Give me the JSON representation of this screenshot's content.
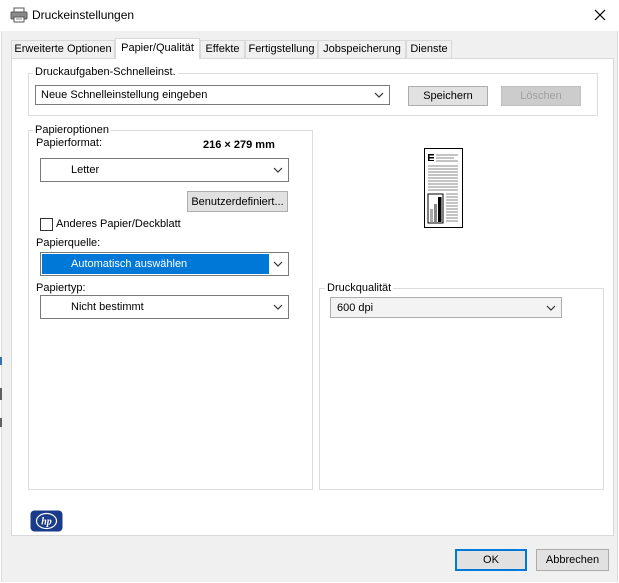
{
  "window": {
    "title": "Druckeinstellungen",
    "icons": {
      "app": "printer-icon",
      "close": "close-icon"
    }
  },
  "tabs": [
    {
      "label": "Erweiterte Optionen",
      "active": false
    },
    {
      "label": "Papier/Qualität",
      "active": true
    },
    {
      "label": "Effekte",
      "active": false
    },
    {
      "label": "Fertigstellung",
      "active": false
    },
    {
      "label": "Jobspeicherung",
      "active": false
    },
    {
      "label": "Dienste",
      "active": false
    }
  ],
  "quickset": {
    "group_label": "Druckaufgaben-Schnelleinst.",
    "combo_value": "Neue Schnelleinstellung eingeben",
    "save_label": "Speichern",
    "delete_label": "Löschen"
  },
  "paper": {
    "group_label": "Papieroptionen",
    "format_label": "Papierformat:",
    "size_text": "216 × 279 mm",
    "format_value": "Letter",
    "custom_label": "Benutzerdefiniert...",
    "other_paper_label": "Anderes Papier/Deckblatt",
    "other_paper_checked": false,
    "source_label": "Papierquelle:",
    "source_value": "Automatisch auswählen",
    "type_label": "Papiertyp:",
    "type_value": "Nicht bestimmt"
  },
  "quality": {
    "group_label": "Druckqualität",
    "value": "600 dpi"
  },
  "footer": {
    "ok_label": "OK",
    "cancel_label": "Abbrechen",
    "logo": "hp-logo",
    "logo_text": "hp"
  },
  "colors": {
    "accent": "#0078d7",
    "selection": "#0078d7",
    "logo": "#1a3a8a"
  }
}
